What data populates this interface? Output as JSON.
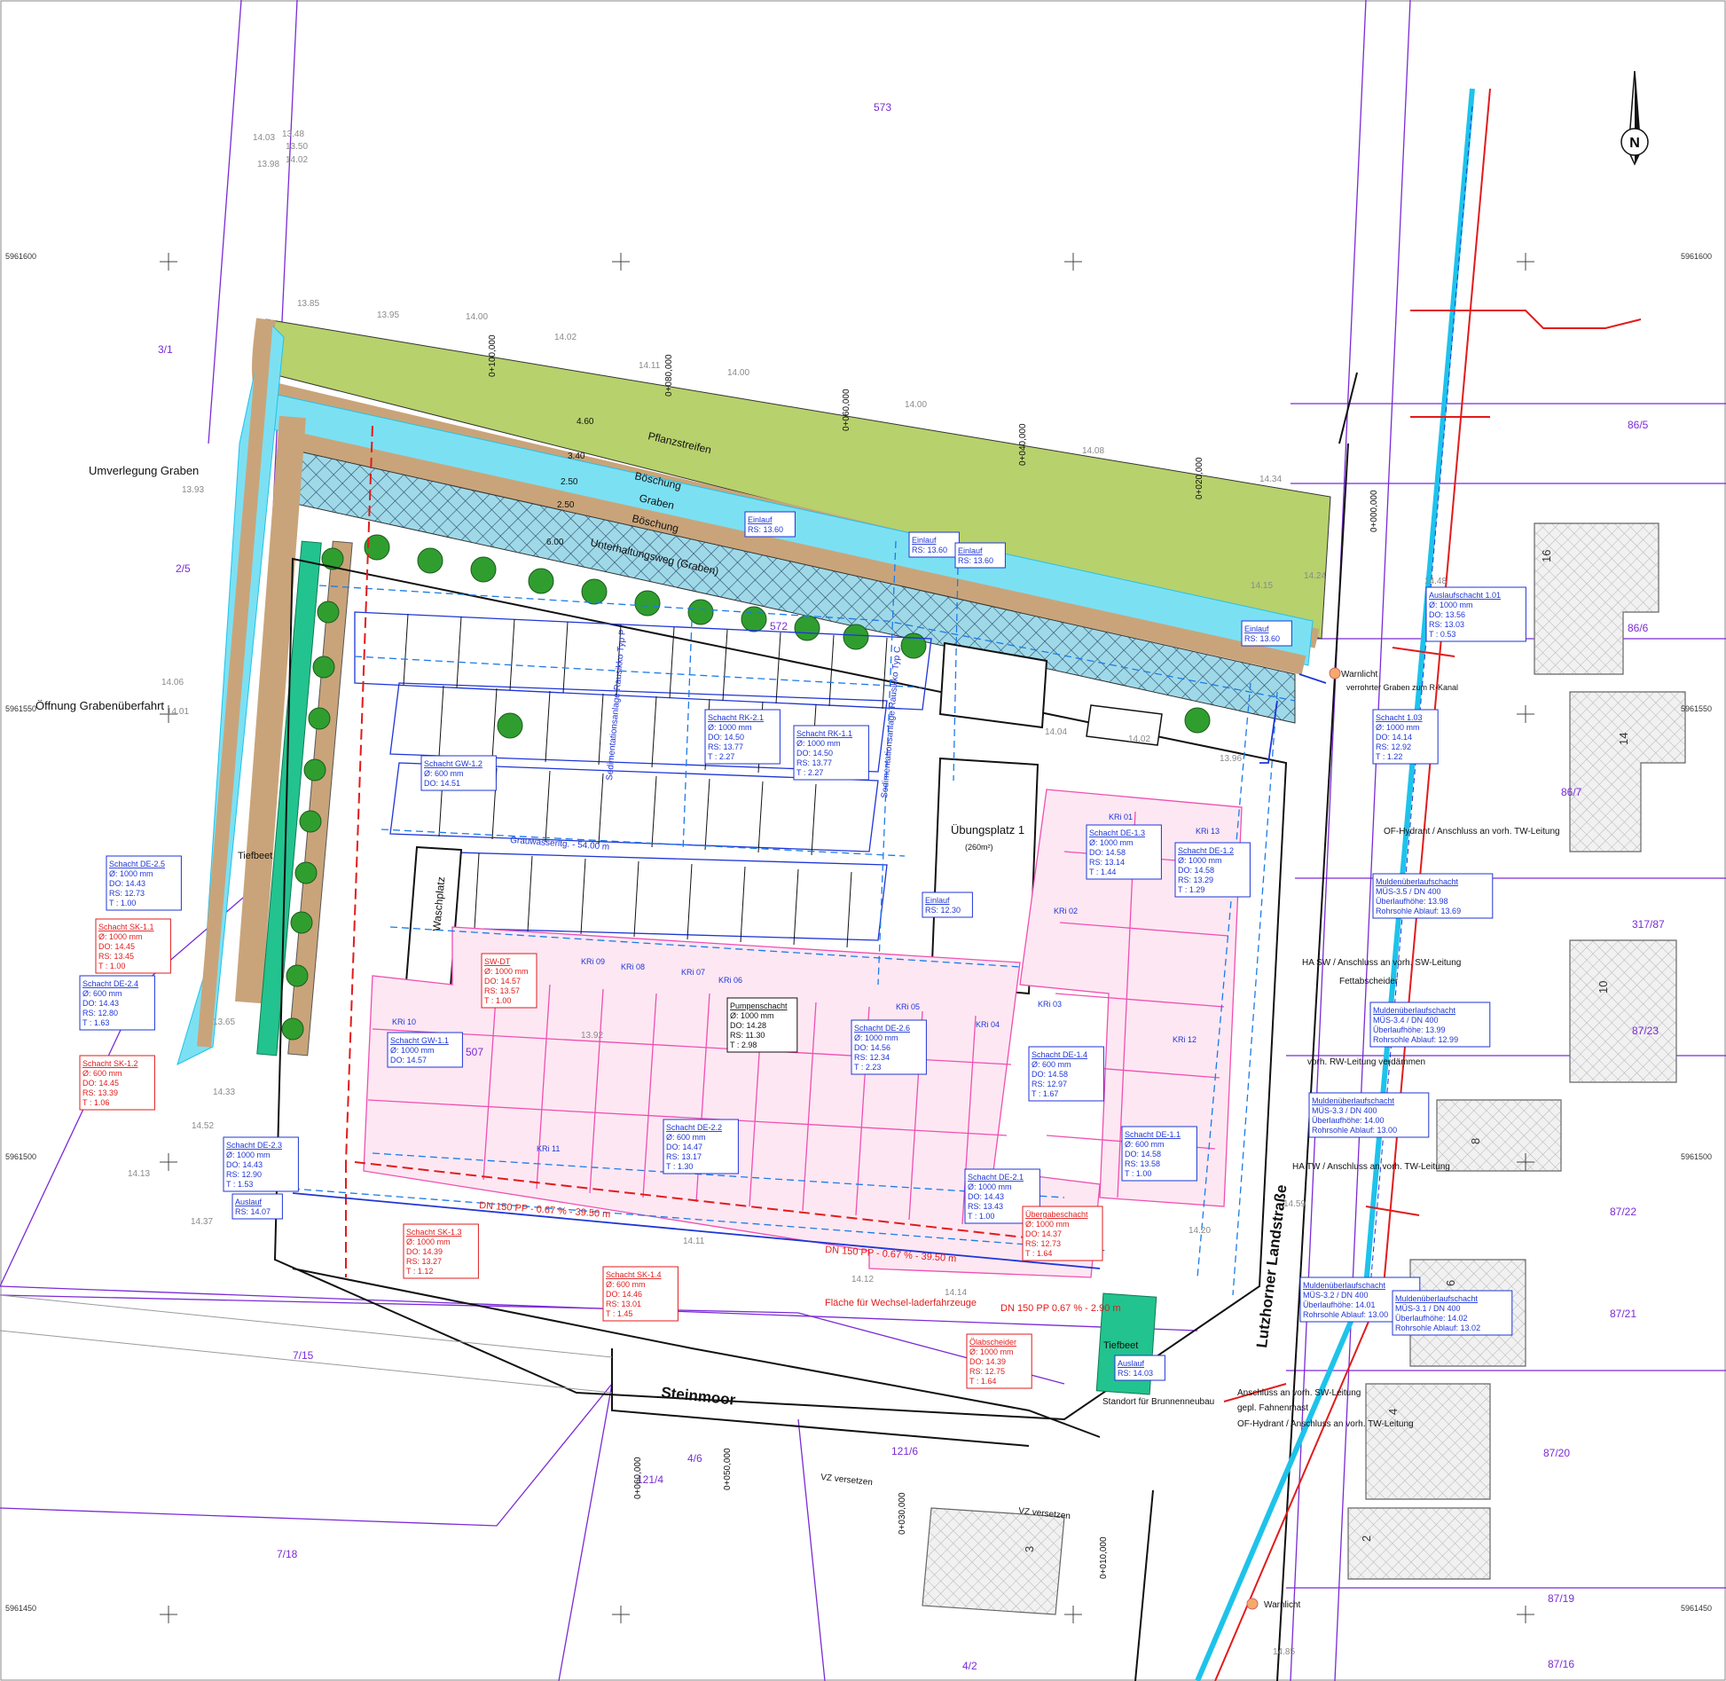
{
  "colors": {
    "parcel": "#7a2bd6",
    "water": "#1ec3ea",
    "blue_line": "#1f35d6",
    "rain_line": "#1b7be8",
    "sewer_red": "#e21b1b",
    "building_pink": "#f04fb0",
    "green_strip": "#b7d16c",
    "berm_brown": "#c9a47a",
    "hatch_grid": "#2a4a6a",
    "shrub": "#2f9e2f",
    "teal": "#22c38e"
  },
  "north_arrow": {
    "icon": "north-arrow-icon",
    "letter": "N"
  },
  "parcels": [
    "573",
    "3/1",
    "2/5",
    "86/5",
    "86/6",
    "86/7",
    "317/87",
    "87/23",
    "87/22",
    "87/21",
    "87/20",
    "87/19",
    "87/16",
    "7/15",
    "7/18",
    "121/4",
    "4/6",
    "121/6",
    "4/2",
    "572",
    "507"
  ],
  "house_numbers": [
    "16",
    "14",
    "10",
    "8",
    "6",
    "4",
    "2",
    "3"
  ],
  "labels": {
    "umverlegung": "Umverlegung Graben",
    "oeffnung": "Öffnung Grabenüberfahrt",
    "pflanzstreifen": "Pflanzstreifen",
    "boeschung1": "Böschung",
    "graben": "Graben",
    "boeschung2": "Böschung",
    "unterhaltungsweg": "Unterhaltungsweg (Graben)",
    "uebungsplatz": "Übungsplatz 1",
    "uebungsplatz_area": "(260m²)",
    "waschplatz": "Waschplatz",
    "tiefbeet1": "Tiefbeet",
    "tiefbeet2": "Tiefbeet",
    "steinmoor": "Steinmoor",
    "lutzhorner": "Lutzhorner Landstraße",
    "flaeche": "Fläche für Wechsel-laderfahrzeuge",
    "grauwasser": "Grauwasserltg. - 54.00 m",
    "sedi1": "Sedimentationsanlage Rausikko Typ P",
    "sedi2": "Sedimentationsanlage Rausikko Typ C",
    "warnlicht1": "Warnlicht",
    "warnlicht2": "Warnlicht",
    "verrohrter": "verrohrter Graben zum R-Kanal",
    "of_hydrant1": "OF-Hydrant / Anschluss an vorh. TW-Leitung",
    "ha_sw": "HA SW / Anschluss an vorh. SW-Leitung",
    "fettabscheider": "Fettabscheider",
    "rw_leitung": "vorh. RW-Leitung verdämmen",
    "ha_tw": "HA TW / Anschluss an vorh. TW-Leitung",
    "anschluss_sw": "Anschluss an vorh. SW-Leitung",
    "fahnenmast": "gepl. Fahnenmast",
    "of_hydrant2": "OF-Hydrant / Anschluss an vorh. TW-Leitung",
    "standort": "Standort für Brunnenneubau",
    "vz1": "VZ versetzen",
    "vz2": "VZ versetzen",
    "dn_pp1": "DN 150 PP - 0.67 % - 39.50 m",
    "dn_pp2": "DN 150 PP - 0.67 % - 39.50 m",
    "dn_pp3": "DN 150 PP 0.67 % - 2.90 m"
  },
  "stations": [
    "0+000,000",
    "0+020,000",
    "0+040,000",
    "0+060,000",
    "0+080,000",
    "0+100,000",
    "0+010,000",
    "0+030,000",
    "0+050,000",
    "0+060,000"
  ],
  "dims": [
    "4.60",
    "3.40",
    "2.50",
    "2.50",
    "6.00"
  ],
  "elevations": [
    "14.03",
    "13.98",
    "13.48",
    "13.50",
    "14.02",
    "13.85",
    "13.95",
    "14.00",
    "14.02",
    "14.11",
    "14.00",
    "14.00",
    "14.08",
    "14.34",
    "14.48",
    "14.24",
    "14.15",
    "13.96",
    "14.02",
    "14.04",
    "13.93",
    "14.06",
    "14.01",
    "13.65",
    "14.33",
    "14.52",
    "14.13",
    "14.37",
    "13.92",
    "14.11",
    "14.12",
    "14.14",
    "14.20",
    "14.85",
    "14.59"
  ],
  "grid_coords": [
    "5961600",
    "5961550",
    "5961500",
    "5961450"
  ],
  "boxes_blue": [
    {
      "id": "box-de-25",
      "lines": [
        "Schacht DE-2.5",
        "Ø: 1000 mm",
        "DO: 14.43",
        "RS: 12.73",
        "T : 1.00"
      ]
    },
    {
      "id": "box-de-24",
      "lines": [
        "Schacht DE-2.4",
        "Ø: 600 mm",
        "DO: 14.43",
        "RS: 12.80",
        "T : 1.63"
      ]
    },
    {
      "id": "box-de-23",
      "lines": [
        "Schacht DE-2.3",
        "Ø: 1000 mm",
        "DO: 14.43",
        "RS: 12.90",
        "T : 1.53"
      ]
    },
    {
      "id": "box-auslauf1",
      "lines": [
        "Auslauf",
        "RS: 14.07"
      ]
    },
    {
      "id": "box-gw-12",
      "lines": [
        "Schacht GW-1.2",
        "Ø: 600 mm",
        "DO: 14.51"
      ]
    },
    {
      "id": "box-gw-11",
      "lines": [
        "Schacht GW-1.1",
        "Ø: 1000 mm",
        "DO: 14.57"
      ]
    },
    {
      "id": "box-rk-21",
      "lines": [
        "Schacht RK-2.1",
        "Ø: 1000 mm",
        "DO: 14.50",
        "RS: 13.77",
        "T : 2.27"
      ]
    },
    {
      "id": "box-rk-11",
      "lines": [
        "Schacht RK-1.1",
        "Ø: 1000 mm",
        "DO: 14.50",
        "RS: 13.77",
        "T : 2.27"
      ]
    },
    {
      "id": "box-einlauf1",
      "lines": [
        "Einlauf",
        "RS: 13.60"
      ]
    },
    {
      "id": "box-einlauf2",
      "lines": [
        "Einlauf",
        "RS: 13.60"
      ]
    },
    {
      "id": "box-einlauf3",
      "lines": [
        "Einlauf",
        "RS: 13.60"
      ]
    },
    {
      "id": "box-einlauf4",
      "lines": [
        "Einlauf",
        "RS: 13.60"
      ]
    },
    {
      "id": "box-einlauf5",
      "lines": [
        "Einlauf",
        "RS: 12.30"
      ]
    },
    {
      "id": "box-ausl-101",
      "lines": [
        "Auslaufschacht 1.01",
        "Ø: 1000 mm",
        "DO: 13.56",
        "RS: 13.03",
        "T : 0.53"
      ]
    },
    {
      "id": "box-103",
      "lines": [
        "Schacht 1.03",
        "Ø: 1000 mm",
        "DO: 14.14",
        "RS: 12.92",
        "T : 1.22"
      ]
    },
    {
      "id": "box-de-13",
      "lines": [
        "Schacht DE-1.3",
        "Ø: 1000 mm",
        "DO: 14.58",
        "RS: 13.14",
        "T : 1.44"
      ]
    },
    {
      "id": "box-de-12",
      "lines": [
        "Schacht DE-1.2",
        "Ø: 1000 mm",
        "DO: 14.58",
        "RS: 13.29",
        "T : 1.29"
      ]
    },
    {
      "id": "box-de-26",
      "lines": [
        "Schacht DE-2.6",
        "Ø: 1000 mm",
        "DO: 14.56",
        "RS: 12.34",
        "T : 2.23"
      ]
    },
    {
      "id": "box-de-14",
      "lines": [
        "Schacht DE-1.4",
        "Ø: 600 mm",
        "DO: 14.58",
        "RS: 12.97",
        "T : 1.67"
      ]
    },
    {
      "id": "box-de-11",
      "lines": [
        "Schacht DE-1.1",
        "Ø: 600 mm",
        "DO: 14.58",
        "RS: 13.58",
        "T : 1.00"
      ]
    },
    {
      "id": "box-de-22",
      "lines": [
        "Schacht DE-2.2",
        "Ø: 600 mm",
        "DO: 14.47",
        "RS: 13.17",
        "T : 1.30"
      ]
    },
    {
      "id": "box-de-21",
      "lines": [
        "Schacht DE-2.1",
        "Ø: 1000 mm",
        "DO: 14.43",
        "RS: 13.43",
        "T : 1.00"
      ]
    },
    {
      "id": "box-mues-35",
      "lines": [
        "Muldenüberlaufschacht",
        "MÜS-3.5 / DN 400",
        "Überlaufhöhe: 13.98",
        "Rohrsohle Ablauf: 13.69"
      ]
    },
    {
      "id": "box-mues-34",
      "lines": [
        "Muldenüberlaufschacht",
        "MÜS-3.4 / DN 400",
        "Überlaufhöhe: 13.99",
        "Rohrsohle Ablauf: 12.99"
      ]
    },
    {
      "id": "box-mues-33",
      "lines": [
        "Muldenüberlaufschacht",
        "MÜS-3.3 / DN 400",
        "Überlaufhöhe: 14.00",
        "Rohrsohle Ablauf: 13.00"
      ]
    },
    {
      "id": "box-mues-32",
      "lines": [
        "Muldenüberlaufschacht",
        "MÜS-3.2 / DN 400",
        "Überlaufhöhe: 14.01",
        "Rohrsohle Ablauf: 13.00"
      ]
    },
    {
      "id": "box-mues-31",
      "lines": [
        "Muldenüberlaufschacht",
        "MÜS-3.1 / DN 400",
        "Überlaufhöhe: 14.02",
        "Rohrsohle Ablauf: 13.02"
      ]
    },
    {
      "id": "box-auslauf2",
      "lines": [
        "Auslauf",
        "RS: 14.03"
      ]
    }
  ],
  "boxes_red": [
    {
      "id": "box-sk-11",
      "lines": [
        "Schacht SK-1.1",
        "Ø: 1000 mm",
        "DO: 14.45",
        "RS: 13.45",
        "T : 1.00"
      ]
    },
    {
      "id": "box-sk-12",
      "lines": [
        "Schacht SK-1.2",
        "Ø: 600 mm",
        "DO: 14.45",
        "RS: 13.39",
        "T : 1.06"
      ]
    },
    {
      "id": "box-swdt",
      "lines": [
        "SW-DT",
        "Ø: 1000 mm",
        "DO: 14.57",
        "RS: 13.57",
        "T : 1.00"
      ]
    },
    {
      "id": "box-sk-13",
      "lines": [
        "Schacht SK-1.3",
        "Ø: 1000 mm",
        "DO: 14.39",
        "RS: 13.27",
        "T : 1.12"
      ]
    },
    {
      "id": "box-sk-14",
      "lines": [
        "Schacht SK-1.4",
        "Ø: 600 mm",
        "DO: 14.46",
        "RS: 13.01",
        "T : 1.45"
      ]
    },
    {
      "id": "box-ueber",
      "lines": [
        "Übergabeschacht",
        "Ø: 1000 mm",
        "DO: 14.37",
        "RS: 12.73",
        "T : 1.64"
      ]
    },
    {
      "id": "box-oel",
      "lines": [
        "Ölabscheider",
        "Ø: 1000 mm",
        "DO: 14.39",
        "RS: 12.75",
        "T : 1.64"
      ]
    }
  ],
  "box_black": {
    "id": "box-pumpen",
    "lines": [
      "Pumpenschacht",
      "Ø: 1000 mm",
      "DO: 14.28",
      "RS: 11.30",
      "T : 2.98"
    ]
  },
  "kri": [
    "KRi 01",
    "KRi 02",
    "KRi 03",
    "KRi 04",
    "KRi 05",
    "KRi 06",
    "KRi 07",
    "KRi 08",
    "KRi 09",
    "KRi 10",
    "KRi 11",
    "KRi 12",
    "KRi 13"
  ]
}
